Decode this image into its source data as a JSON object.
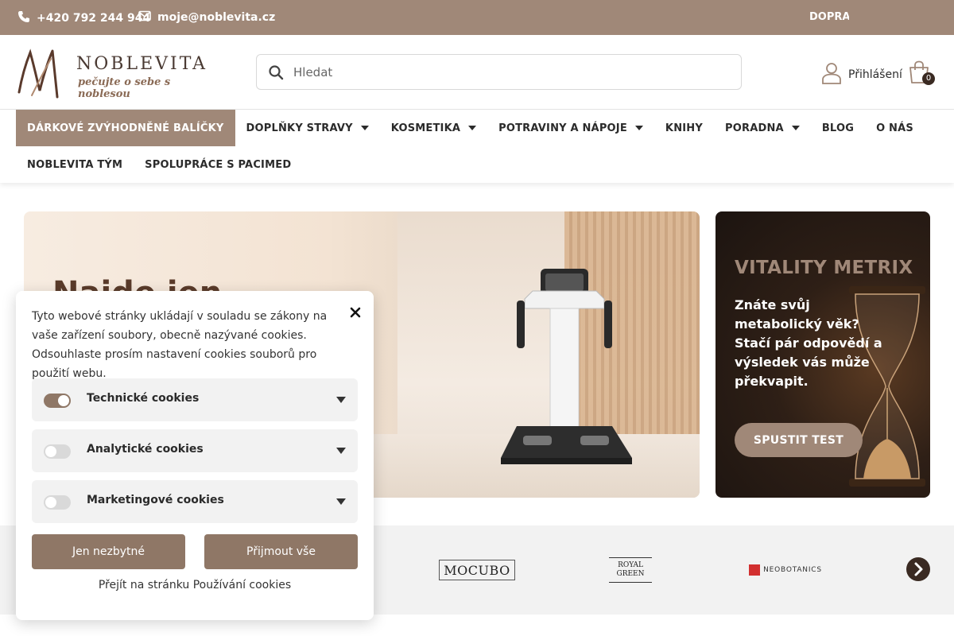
{
  "topbar": {
    "phone": "+420 792 244 944",
    "email": "moje@noblevita.cz",
    "promo": "DOPRA"
  },
  "header": {
    "logo_brand": "NOBLEVITA",
    "logo_tagline": "pečujte o sebe s noblesou",
    "search_placeholder": "Hledat",
    "login_label": "Přihlášení",
    "cart_count": "0"
  },
  "nav": {
    "row1": [
      {
        "label": "DÁRKOVÉ ZVÝHODNĚNÉ BALÍČKY",
        "dropdown": false,
        "active": true
      },
      {
        "label": "DOPLŇKY STRAVY",
        "dropdown": true
      },
      {
        "label": "KOSMETIKA",
        "dropdown": true
      },
      {
        "label": "POTRAVINY A NÁPOJE",
        "dropdown": true
      },
      {
        "label": "KNIHY",
        "dropdown": false
      },
      {
        "label": "PORADNA",
        "dropdown": true
      },
      {
        "label": "BLOG",
        "dropdown": false
      },
      {
        "label": "O NÁS",
        "dropdown": false
      }
    ],
    "row2": [
      {
        "label": "NOBLEVITA TÝM",
        "dropdown": false
      },
      {
        "label": "SPOLUPRÁCE S PACIMED",
        "dropdown": false
      }
    ]
  },
  "hero": {
    "title": "Najde jen"
  },
  "vitality": {
    "title": "VITALITY METRIX",
    "text_line1": "Znáte svůj metabolický věk?",
    "text_line2": "Stačí pár odpovědí a výsledek vás může překvapit.",
    "button": "SPUSTIT TEST"
  },
  "brands": {
    "items": [
      {
        "name": "MOCUBO"
      },
      {
        "name_line1": "ROYAL",
        "name_line2": "GREEN"
      },
      {
        "name": "NEOBOTANICS"
      }
    ]
  },
  "cookie": {
    "text": "Tyto webové stránky ukládají v souladu se zákony na vaše zařízení soubory, obecně nazývané cookies. Odsouhlaste prosím nastavení cookies souborů pro použití webu.",
    "categories": [
      {
        "label": "Technické cookies",
        "enabled": true
      },
      {
        "label": "Analytické cookies",
        "enabled": false
      },
      {
        "label": "Marketingové cookies",
        "enabled": false
      }
    ],
    "btn_essential": "Jen nezbytné",
    "btn_accept": "Přijmout vše",
    "link": "Přejít na stránku Používání cookies"
  },
  "colors": {
    "accent": "#a08878",
    "accent_dark": "#8f7766",
    "dark": "#3a2a22"
  }
}
